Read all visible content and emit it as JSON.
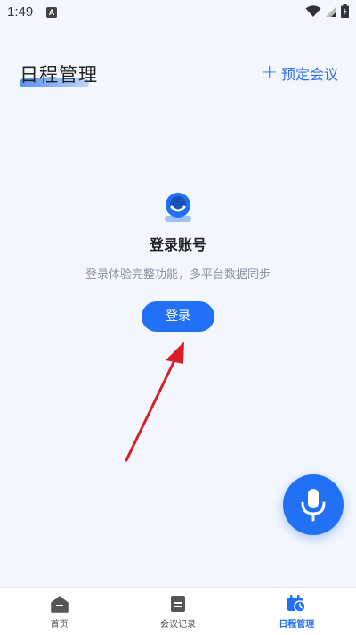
{
  "status_bar": {
    "time": "1:49",
    "app_badge": "A"
  },
  "header": {
    "title": "日程管理",
    "action_label": "预定会议",
    "action_icon": "plus-icon"
  },
  "empty_state": {
    "icon": "user-avatar-icon",
    "heading": "登录账号",
    "description": "登录体验完整功能，多平台数据同步",
    "button_label": "登录"
  },
  "fab": {
    "icon": "microphone-icon"
  },
  "tabbar": {
    "tabs": [
      {
        "label": "首页",
        "icon": "home-icon",
        "active": false
      },
      {
        "label": "会议记录",
        "icon": "document-icon",
        "active": false
      },
      {
        "label": "日程管理",
        "icon": "calendar-clock-icon",
        "active": true
      }
    ]
  },
  "colors": {
    "accent": "#2271f5",
    "background": "#f3f7fd",
    "annotation_arrow": "#d81f26"
  }
}
